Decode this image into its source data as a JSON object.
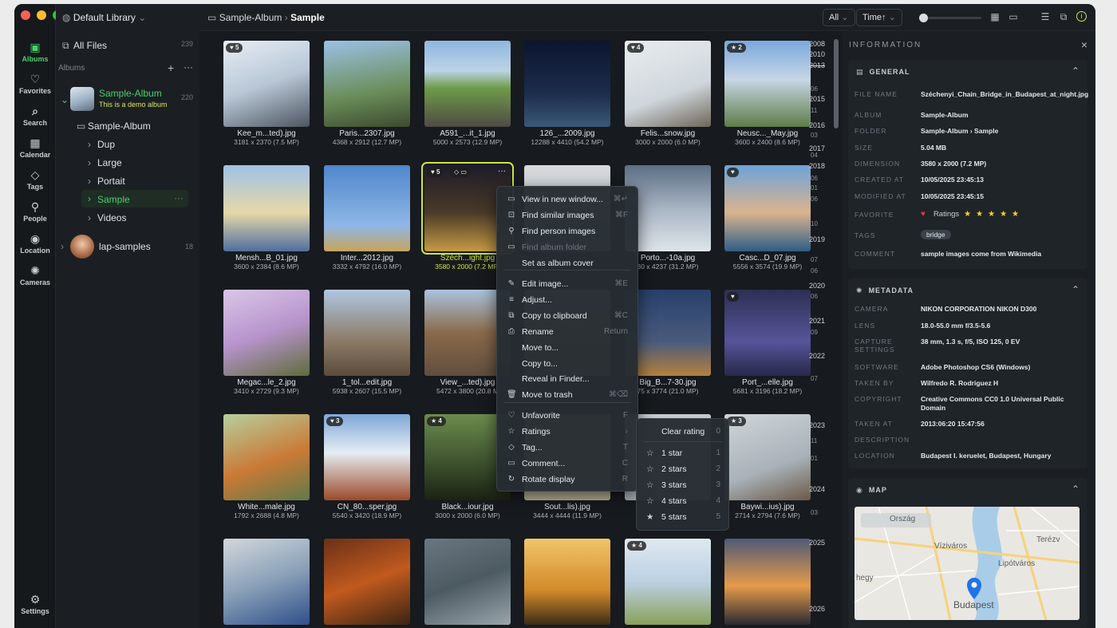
{
  "rail": {
    "items": [
      {
        "label": "Albums"
      },
      {
        "label": "Favorites"
      },
      {
        "label": "Search"
      },
      {
        "label": "Calendar"
      },
      {
        "label": "Tags"
      },
      {
        "label": "People"
      },
      {
        "label": "Location"
      },
      {
        "label": "Cameras"
      }
    ],
    "settings": "Settings"
  },
  "sidebar": {
    "library": "Default Library",
    "all_files": "All Files",
    "all_files_count": "239",
    "albums_label": "Albums",
    "album1": {
      "title": "Sample-Album",
      "subtitle": "This is a demo album",
      "count": "220"
    },
    "folder": "Sample-Album",
    "subfolders": [
      "Dup",
      "Large",
      "Portait",
      "Sample",
      "Videos"
    ],
    "album2": {
      "title": "lap-samples",
      "count": "18"
    }
  },
  "header": {
    "crumb1": "Sample-Album",
    "crumb2": "Sample",
    "filter": "All",
    "sort": "Time↑"
  },
  "grid": {
    "photos": [
      {
        "name": "Kee_m...ted).jpg",
        "dim": "3181 x 2370 (7.5 MP)",
        "badge": "♥ 5"
      },
      {
        "name": "Paris...2307.jpg",
        "dim": "4368 x 2912 (12.7 MP)"
      },
      {
        "name": "A591_...it_1.jpg",
        "dim": "5000 x 2573 (12.9 MP)"
      },
      {
        "name": "126_...2009.jpg",
        "dim": "12288 x 4410 (54.2 MP)"
      },
      {
        "name": "Felis...snow.jpg",
        "dim": "3000 x 2000 (6.0 MP)",
        "badge": "♥ 4"
      },
      {
        "name": "Neusc..._May.jpg",
        "dim": "3600 x 2400 (8.6 MP)",
        "badge": "★ 2"
      },
      {
        "name": "Mensh...B_01.jpg",
        "dim": "3600 x 2384 (8.6 MP)"
      },
      {
        "name": "Inter...2012.jpg",
        "dim": "3332 x 4792 (16.0 MP)"
      },
      {
        "name": "Széch...ight.jpg",
        "dim": "3580 x 2000 (7.2 MP)",
        "badge": "♥ 5"
      },
      {
        "name": "",
        "dim": ""
      },
      {
        "name": "Porto...-10a.jpg",
        "dim": "30 x 4237 (31.2 MP)"
      },
      {
        "name": "Casc...D_07.jpg",
        "dim": "5556 x 3574 (19.9 MP)",
        "badge": "♥"
      },
      {
        "name": "Megac...le_2.jpg",
        "dim": "3410 x 2729 (9.3 MP)"
      },
      {
        "name": "1_tol...edit.jpg",
        "dim": "5938 x 2607 (15.5 MP)"
      },
      {
        "name": "View_...ted).jpg",
        "dim": "5472 x 3800 (20.8 M"
      },
      {
        "name": "",
        "dim": ""
      },
      {
        "name": "Big_B...7-30.jpg",
        "dim": "75 x 3774 (21.0 MP)"
      },
      {
        "name": "Port_...elle.jpg",
        "dim": "5681 x 3196 (18.2 MP)",
        "badge": "♥"
      },
      {
        "name": "White...male.jpg",
        "dim": "1792 x 2688 (4.8 MP)"
      },
      {
        "name": "CN_80...sper.jpg",
        "dim": "5540 x 3420 (18.9 MP)",
        "badge": "♥ 3"
      },
      {
        "name": "Black...iour.jpg",
        "dim": "3000 x 2000 (6.0 MP)",
        "badge": "★ 4"
      },
      {
        "name": "Sout...lis).jpg",
        "dim": "3444 x 4444 (11.9 MP)"
      },
      {
        "name": "",
        "dim": ""
      },
      {
        "name": "Baywi...ius).jpg",
        "dim": "2714 x 2794 (7.6 MP)",
        "badge": "★ 3"
      },
      {
        "name": "",
        "dim": ""
      },
      {
        "name": "",
        "dim": ""
      },
      {
        "name": "",
        "dim": ""
      },
      {
        "name": "",
        "dim": ""
      },
      {
        "name": "",
        "dim": "",
        "badge": "★ 4"
      },
      {
        "name": "",
        "dim": ""
      }
    ]
  },
  "timeline": {
    "years": [
      "2008",
      "2010",
      "2013",
      "2015",
      "2016",
      "2017",
      "2018",
      "2019",
      "2020",
      "2021",
      "2022",
      "2023",
      "2024",
      "2025",
      "2026"
    ],
    "months": [
      "06",
      "11",
      "03",
      "04",
      "06",
      "01",
      "06",
      "10",
      "07",
      "06",
      "06",
      "09",
      "07",
      "11",
      "01",
      "03"
    ]
  },
  "context_menu": {
    "items": [
      {
        "label": "View in new window...",
        "shortcut": "⌘↵"
      },
      {
        "label": "Find similar images",
        "shortcut": "⌘F"
      },
      {
        "label": "Find person images",
        "shortcut": ""
      },
      {
        "label": "Find album folder",
        "shortcut": ""
      },
      {
        "label": "Set as album cover",
        "shortcut": ""
      },
      {
        "label": "Edit image...",
        "shortcut": "⌘E"
      },
      {
        "label": "Adjust...",
        "shortcut": ""
      },
      {
        "label": "Copy to clipboard",
        "shortcut": "⌘C"
      },
      {
        "label": "Rename",
        "shortcut": "Return"
      },
      {
        "label": "Move to...",
        "shortcut": ""
      },
      {
        "label": "Copy to...",
        "shortcut": ""
      },
      {
        "label": "Reveal in Finder...",
        "shortcut": ""
      },
      {
        "label": "Move to trash",
        "shortcut": "⌘⌫"
      },
      {
        "label": "Unfavorite",
        "shortcut": "F"
      },
      {
        "label": "Ratings",
        "shortcut": "›"
      },
      {
        "label": "Tag...",
        "shortcut": "T"
      },
      {
        "label": "Comment...",
        "shortcut": "C"
      },
      {
        "label": "Rotate display",
        "shortcut": "R"
      }
    ]
  },
  "ratings_menu": {
    "items": [
      {
        "label": "Clear rating",
        "shortcut": "0"
      },
      {
        "label": "1 star",
        "shortcut": "1"
      },
      {
        "label": "2 stars",
        "shortcut": "2"
      },
      {
        "label": "3 stars",
        "shortcut": "3"
      },
      {
        "label": "4 stars",
        "shortcut": "4"
      },
      {
        "label": "5 stars",
        "shortcut": "5"
      }
    ]
  },
  "info": {
    "title": "INFORMATION",
    "general": {
      "heading": "GENERAL",
      "rows": [
        {
          "k": "FILE NAME",
          "v": "Széchenyi_Chain_Bridge_in_Budapest_at_night.jpg"
        },
        {
          "k": "ALBUM",
          "v": "Sample-Album"
        },
        {
          "k": "FOLDER",
          "v": "Sample-Album  ›  Sample"
        },
        {
          "k": "SIZE",
          "v": "5.04 MB"
        },
        {
          "k": "DIMENSION",
          "v": "3580 x 2000 (7.2 MP)"
        },
        {
          "k": "CREATED AT",
          "v": "10/05/2025 23:45:13"
        },
        {
          "k": "MODIFIED AT",
          "v": "10/05/2025 23:45:15"
        },
        {
          "k": "FAVORITE",
          "v": ""
        },
        {
          "k": "TAGS",
          "v": ""
        },
        {
          "k": "COMMENT",
          "v": "sample images come from Wikimedia"
        }
      ],
      "ratings_label": "Ratings",
      "rating": 5,
      "tag": "bridge"
    },
    "metadata": {
      "heading": "METADATA",
      "rows": [
        {
          "k": "CAMERA",
          "v": "NIKON CORPORATION NIKON D300"
        },
        {
          "k": "LENS",
          "v": "18.0-55.0 mm f/3.5-5.6"
        },
        {
          "k": "CAPTURE SETTINGS",
          "v": "38 mm, 1.3 s, f/5, ISO 125, 0 EV"
        },
        {
          "k": "SOFTWARE",
          "v": "Adobe Photoshop CS6 (Windows)"
        },
        {
          "k": "TAKEN BY",
          "v": "Wilfredo R. Rodriguez H"
        },
        {
          "k": "COPYRIGHT",
          "v": "Creative Commons CC0 1.0 Universal Public Domain"
        },
        {
          "k": "TAKEN AT",
          "v": "2013:06:20 15:47:56"
        },
        {
          "k": "DESCRIPTION",
          "v": ""
        },
        {
          "k": "LOCATION",
          "v": "Budapest I. keruelet, Budapest, Hungary"
        }
      ]
    },
    "map": {
      "heading": "MAP",
      "labels": [
        "Ország",
        "Víziváros",
        "Terézv",
        "Lipótváros",
        "hegy",
        "Budapest"
      ]
    }
  },
  "colors": {
    "accent": "#45d16a",
    "selection": "#cde63c",
    "star": "#ffd21f",
    "heart": "#e8364a"
  }
}
